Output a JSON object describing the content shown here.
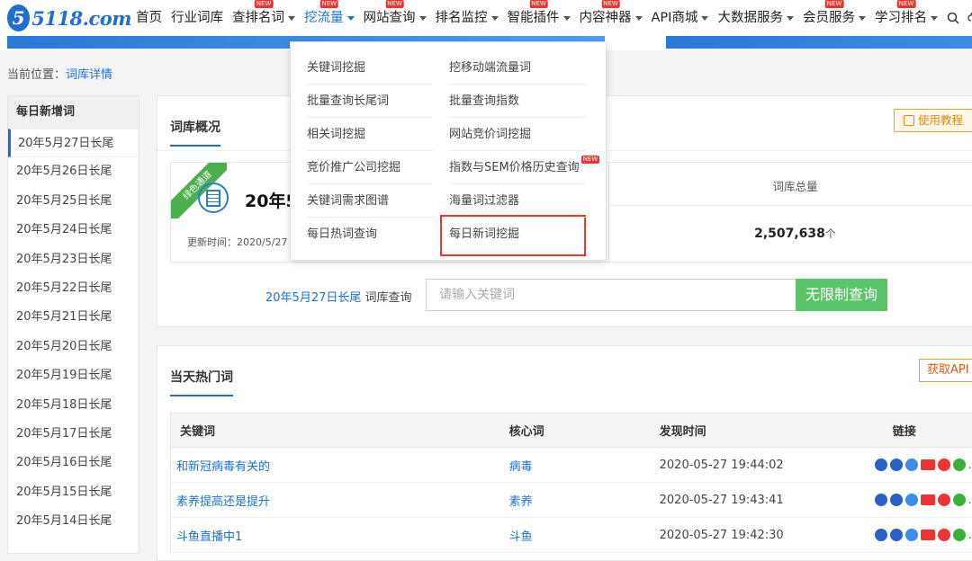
{
  "logo": {
    "mark": "5",
    "text": "5118.com"
  },
  "nav": {
    "items": [
      {
        "label": "首页",
        "caret": false,
        "new": ""
      },
      {
        "label": "行业词库",
        "caret": false,
        "new": ""
      },
      {
        "label": "查排名词",
        "caret": true,
        "new": "NEW"
      },
      {
        "label": "挖流量",
        "caret": true,
        "new": "NEW",
        "active": true
      },
      {
        "label": "网站查询",
        "caret": true,
        "new": "NEW"
      },
      {
        "label": "排名监控",
        "caret": true,
        "new": ""
      },
      {
        "label": "智能插件",
        "caret": true,
        "new": "NEW"
      },
      {
        "label": "内容神器",
        "caret": true,
        "new": "NEW"
      },
      {
        "label": "API商城",
        "caret": true,
        "new": ""
      },
      {
        "label": "大数据服务",
        "caret": true,
        "new": ""
      },
      {
        "label": "会员服务",
        "caret": true,
        "new": "NEW"
      },
      {
        "label": "学习排名",
        "caret": true,
        "new": "NEW"
      }
    ]
  },
  "breadcrumb": {
    "prefix": "当前位置：",
    "link": "词库详情"
  },
  "sidebar": {
    "heading": "每日新增词",
    "items": [
      "20年5月27日长尾",
      "20年5月26日长尾",
      "20年5月25日长尾",
      "20年5月24日长尾",
      "20年5月23日长尾",
      "20年5月22日长尾",
      "20年5月21日长尾",
      "20年5月20日长尾",
      "20年5月19日长尾",
      "20年5月18日长尾",
      "20年5月17日长尾",
      "20年5月16日长尾",
      "20年5月15日长尾",
      "20年5月14日长尾"
    ]
  },
  "overview": {
    "title": "词库概况",
    "tutorial": "使用教程",
    "ribbon": "绿色通道",
    "card_title": "20年5",
    "update_time": "更新时间：2020/5/27 1",
    "total_label": "词库总量",
    "total_value": "2,507,638",
    "total_unit": "个"
  },
  "query": {
    "link": "20年5月27日长尾",
    "suffix": " 词库查询",
    "placeholder": "请输入关键词",
    "button": "无限制查询"
  },
  "hot": {
    "title": "当天热门词",
    "api_button": "获取API",
    "columns": {
      "keyword": "关键词",
      "core": "核心词",
      "time": "发现时间",
      "link": "链接"
    },
    "rows": [
      {
        "keyword": "和新冠病毒有关的",
        "core": "病毒",
        "time": "2020-05-27 19:44:02",
        "more": "..."
      },
      {
        "keyword": "素养提高还是提升",
        "core": "素养",
        "time": "2020-05-27 19:43:41",
        "more": "..."
      },
      {
        "keyword": "斗鱼直播中1",
        "core": "斗鱼",
        "time": "2020-05-27 19:42:30",
        "more": "..."
      }
    ]
  },
  "dropdown": {
    "left": [
      "关键词挖掘",
      "批量查询长尾词",
      "相关词挖掘",
      "竞价推广公司挖掘",
      "关键词需求图谱",
      "每日热词查询"
    ],
    "right": [
      "挖移动端流量词",
      "批量查询指数",
      "网站竞价词挖掘",
      "指数与SEM价格历史查询",
      "海量词过滤器",
      "每日新词挖掘"
    ],
    "new_badge": "NEW"
  },
  "colors": {
    "brand": "#1f6fd1",
    "green": "#5cc36a",
    "highlight": "#e33333"
  }
}
